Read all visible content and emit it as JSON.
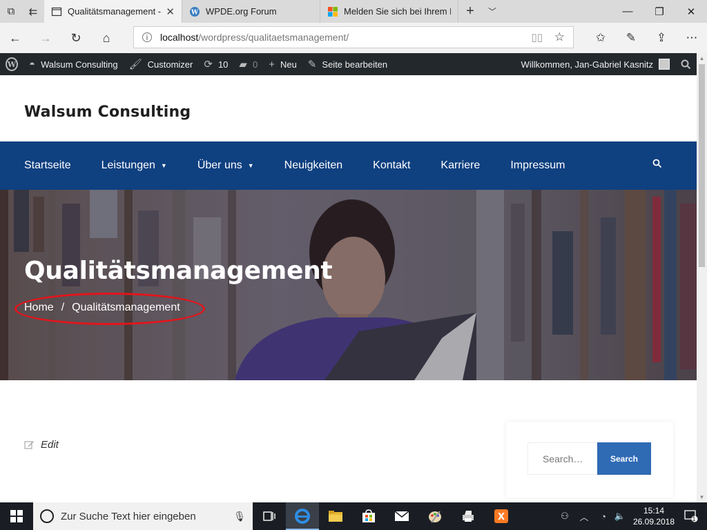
{
  "browser": {
    "tabs": [
      {
        "title": "Qualitätsmanagement -",
        "active": true,
        "icon": "page-icon"
      },
      {
        "title": "WPDE.org Forum",
        "active": false,
        "icon": "wordpress-icon"
      },
      {
        "title": "Melden Sie sich bei Ihrem M",
        "active": false,
        "icon": "microsoft-icon"
      }
    ],
    "url_host": "localhost",
    "url_path": "/wordpress/qualitaetsmanagement/"
  },
  "adminbar": {
    "site": "Walsum Consulting",
    "customizer": "Customizer",
    "updates": "10",
    "comments": "0",
    "new": "Neu",
    "edit_page": "Seite bearbeiten",
    "welcome": "Willkommen, Jan-Gabriel Kasnitz"
  },
  "site": {
    "title": "Walsum Consulting"
  },
  "nav": {
    "items": [
      {
        "label": "Startseite",
        "has_dropdown": false
      },
      {
        "label": "Leistungen",
        "has_dropdown": true
      },
      {
        "label": "Über uns",
        "has_dropdown": true
      },
      {
        "label": "Neuigkeiten",
        "has_dropdown": false
      },
      {
        "label": "Kontakt",
        "has_dropdown": false
      },
      {
        "label": "Karriere",
        "has_dropdown": false
      },
      {
        "label": "Impressum",
        "has_dropdown": false
      }
    ]
  },
  "hero": {
    "title": "Qualitätsmanagement",
    "breadcrumb_home": "Home",
    "breadcrumb_sep": "/",
    "breadcrumb_current": "Qualitätsmanagement"
  },
  "content": {
    "edit_label": "Edit"
  },
  "search_widget": {
    "placeholder": "Search…",
    "button": "Search"
  },
  "taskbar": {
    "search_placeholder": "Zur Suche Text hier eingeben",
    "time": "15:14",
    "date": "26.09.2018",
    "notifications": "1"
  },
  "colors": {
    "nav_bg": "#0f4080",
    "admin_bg": "#23282d",
    "search_button": "#2f6ab5",
    "annotation_ring": "#e4141b"
  }
}
